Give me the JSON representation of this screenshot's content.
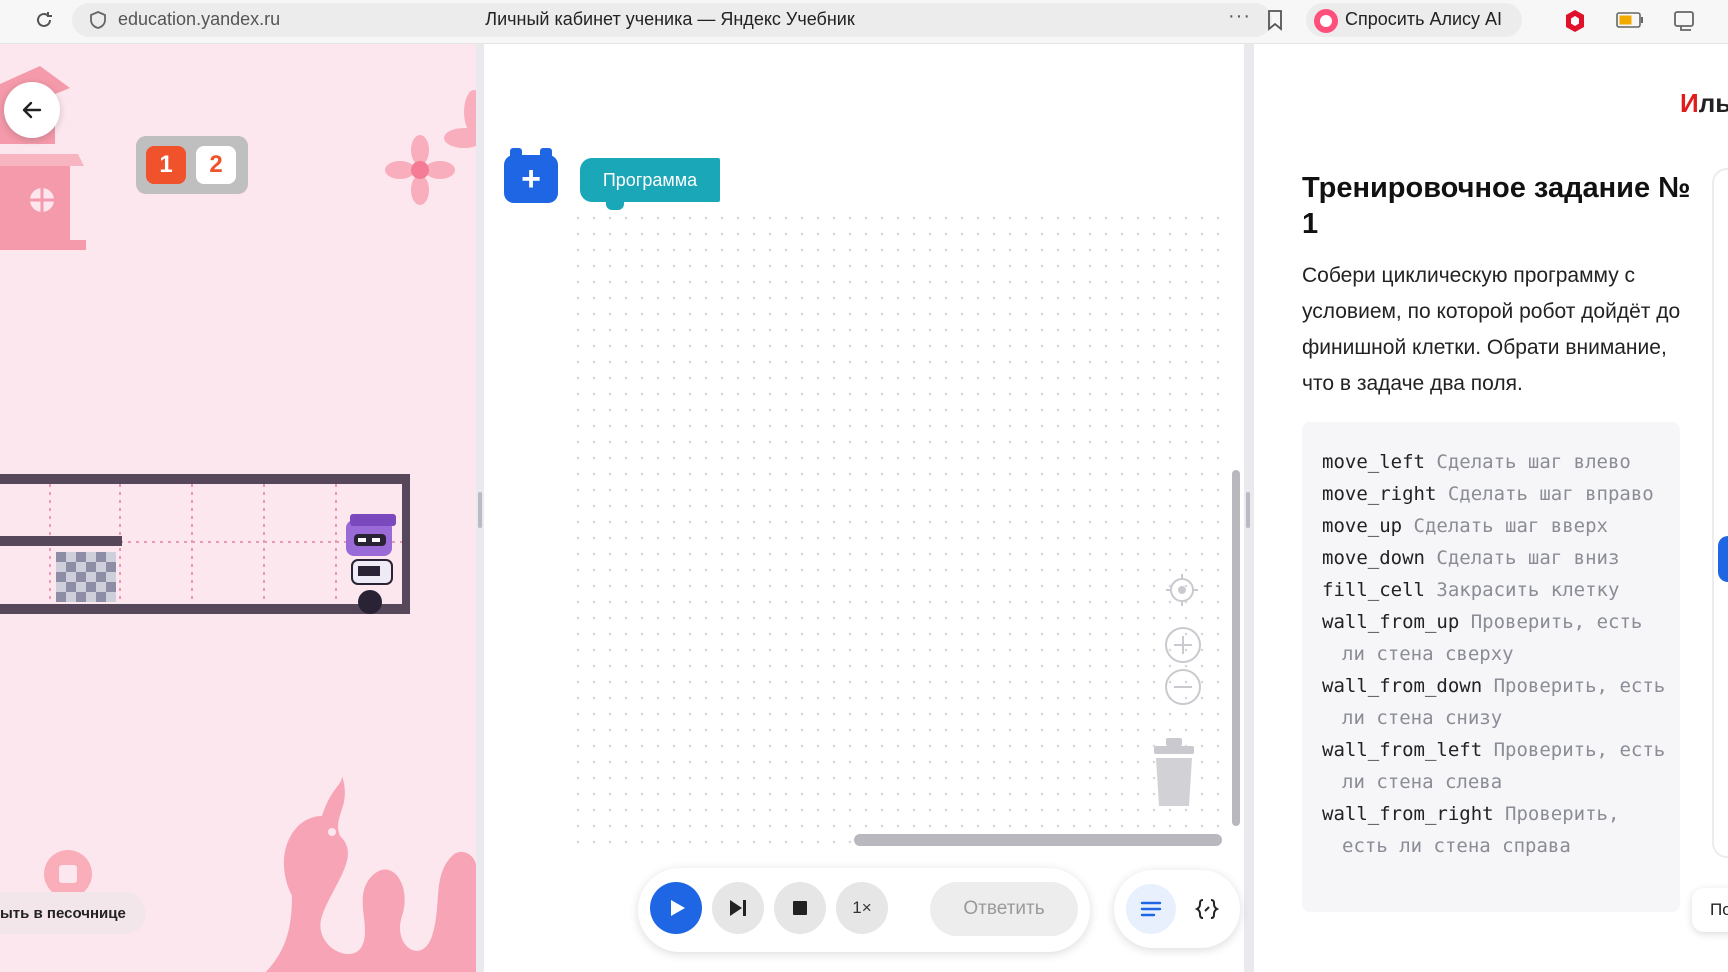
{
  "browser": {
    "url": "education.yandex.ru",
    "title": "Личный кабинет ученика — Яндекс Учебник",
    "more": "···",
    "alice_label": "Спросить Алису AI"
  },
  "game": {
    "fields": [
      "1",
      "2"
    ],
    "sandbox_label": "ыть в песочнице"
  },
  "editor": {
    "program_label": "Программа"
  },
  "controls": {
    "speed_label": "1×",
    "answer_label": "Ответить"
  },
  "task": {
    "user_name_accent": "И",
    "user_name_rest": "лья",
    "title": "Тренировочное задание № 1",
    "description": "Собери циклическую программу с условием, по которой робот дойдёт до финишной клетки. Обрати внимание, что в задаче два поля.",
    "commands": [
      {
        "name": "move_left",
        "desc": "Сделать шаг влево"
      },
      {
        "name": "move_right",
        "desc": "Сделать шаг вправо"
      },
      {
        "name": "move_up",
        "desc": "Сделать шаг вверх"
      },
      {
        "name": "move_down",
        "desc": "Сделать шаг вниз"
      },
      {
        "name": "fill_cell",
        "desc": "Закрасить клетку"
      },
      {
        "name": "wall_from_up",
        "desc": "Проверить, есть ли стена сверху"
      },
      {
        "name": "wall_from_down",
        "desc": "Проверить, есть ли стена снизу"
      },
      {
        "name": "wall_from_left",
        "desc": "Проверить, есть ли стена слева"
      },
      {
        "name": "wall_from_right",
        "desc": "Проверить, есть ли стена справа"
      }
    ],
    "side_pill_label": "По"
  },
  "colors": {
    "accent_blue": "#1e66e3",
    "program_teal": "#1aa7b8",
    "game_bg": "#fde7ee",
    "field_active": "#f0532b"
  }
}
